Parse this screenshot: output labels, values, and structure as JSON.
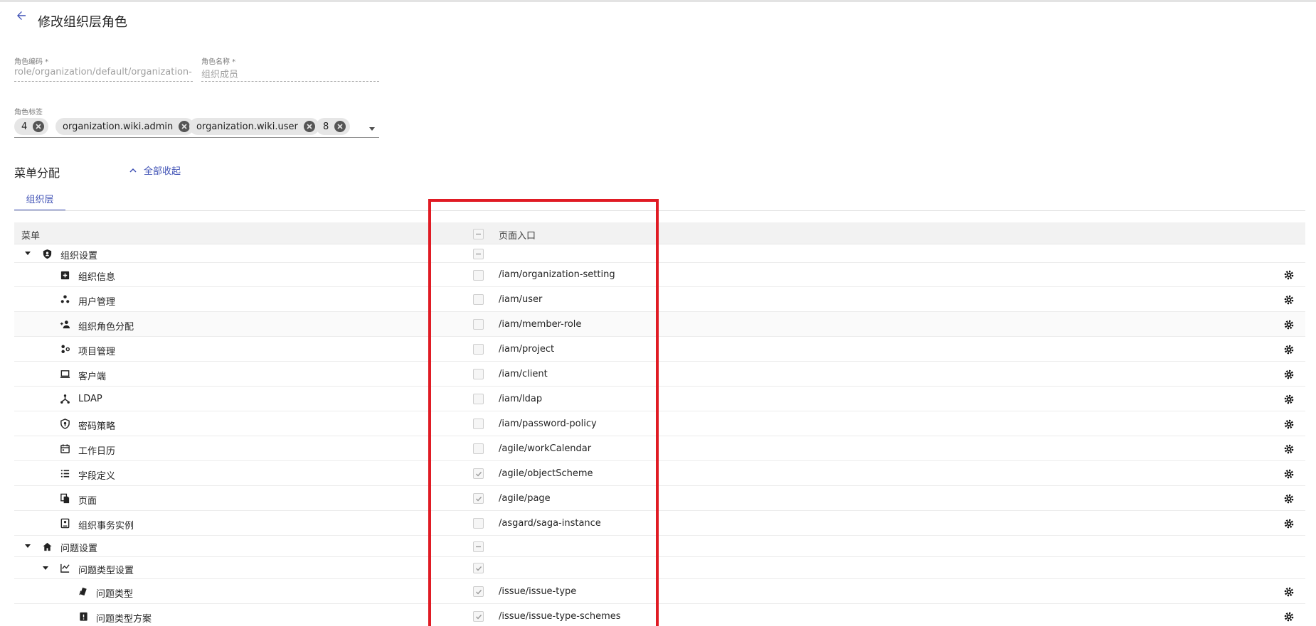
{
  "header": {
    "title": "修改组织层角色"
  },
  "form": {
    "role_code": {
      "label": "角色编码 *",
      "value": "role/organization/default/organization-mer"
    },
    "role_name": {
      "label": "角色名称 *",
      "value": "组织成员"
    },
    "role_tags": {
      "label": "角色标签",
      "tags": [
        "4",
        "organization.wiki.admin",
        "organization.wiki.user",
        "8"
      ]
    }
  },
  "menu_section": {
    "title": "菜单分配",
    "collapse_all": "全部收起",
    "tabs": [
      "组织层"
    ]
  },
  "table": {
    "headers": {
      "menu": "菜单",
      "route": "页面入口"
    },
    "rows": [
      {
        "label": "组织设置",
        "icon": "shield-account-icon",
        "level": 0,
        "expandable": true,
        "checkbox": "indeterminate",
        "route": "",
        "gear": false
      },
      {
        "label": "组织信息",
        "icon": "domain-info-icon",
        "level": 1,
        "checkbox": "unchecked",
        "route": "/iam/organization-setting",
        "gear": true
      },
      {
        "label": "用户管理",
        "icon": "user-manage-icon",
        "level": 1,
        "checkbox": "unchecked",
        "route": "/iam/user",
        "gear": true
      },
      {
        "label": "组织角色分配",
        "icon": "person-add-icon",
        "level": 1,
        "checkbox": "unchecked",
        "route": "/iam/member-role",
        "gear": true
      },
      {
        "label": "项目管理",
        "icon": "project-manage-icon",
        "level": 1,
        "checkbox": "unchecked",
        "route": "/iam/project",
        "gear": true
      },
      {
        "label": "客户端",
        "icon": "laptop-icon",
        "level": 1,
        "checkbox": "unchecked",
        "route": "/iam/client",
        "gear": true
      },
      {
        "label": "LDAP",
        "icon": "ldap-network-icon",
        "level": 1,
        "checkbox": "unchecked",
        "route": "/iam/ldap",
        "gear": true
      },
      {
        "label": "密码策略",
        "icon": "security-shield-icon",
        "level": 1,
        "checkbox": "unchecked",
        "route": "/iam/password-policy",
        "gear": true
      },
      {
        "label": "工作日历",
        "icon": "calendar-icon",
        "level": 1,
        "checkbox": "unchecked",
        "route": "/agile/workCalendar",
        "gear": true
      },
      {
        "label": "字段定义",
        "icon": "list-icon",
        "level": 1,
        "checkbox": "checked",
        "route": "/agile/objectScheme",
        "gear": true
      },
      {
        "label": "页面",
        "icon": "file-copy-icon",
        "level": 1,
        "checkbox": "checked",
        "route": "/agile/page",
        "gear": true
      },
      {
        "label": "组织事务实例",
        "icon": "saga-instance-icon",
        "level": 1,
        "checkbox": "unchecked",
        "route": "/asgard/saga-instance",
        "gear": true
      },
      {
        "label": "问题设置",
        "icon": "home-icon",
        "level": 0,
        "expandable": true,
        "checkbox": "indeterminate",
        "route": "",
        "gear": false
      },
      {
        "label": "问题类型设置",
        "icon": "chart-line-icon",
        "level": 1,
        "expandable": true,
        "checkbox": "checked",
        "route": "",
        "gear": false
      },
      {
        "label": "问题类型",
        "icon": "cards-icon",
        "level": 2,
        "checkbox": "checked",
        "route": "/issue/issue-type",
        "gear": true
      },
      {
        "label": "问题类型方案",
        "icon": "clipboard-alert-icon",
        "level": 2,
        "checkbox": "checked",
        "route": "/issue/issue-type-schemes",
        "gear": true
      }
    ]
  },
  "colors": {
    "accent": "#3f51b5",
    "highlight": "#e01b24"
  }
}
